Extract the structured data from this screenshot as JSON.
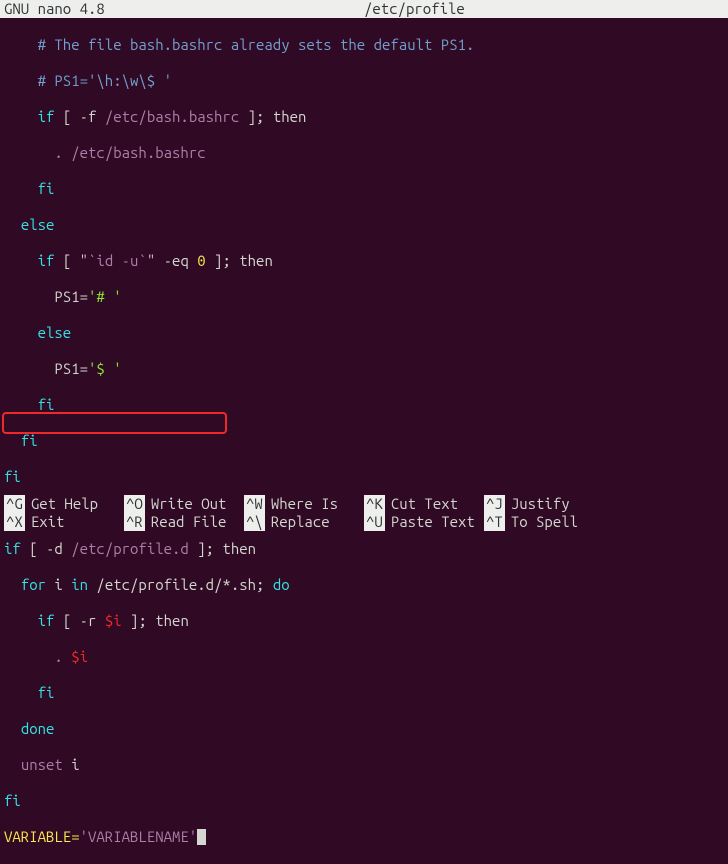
{
  "header": {
    "app": "GNU nano 4.8",
    "filename": "/etc/profile"
  },
  "code": {
    "l1_comment": "# The file bash.bashrc already sets the default PS1.",
    "l2_comment": "# PS1='\\h:\\w\\$ '",
    "l3_if": "if",
    "l3_test": " [ -f ",
    "l3_path": "/etc/bash.bashrc",
    "l3_then": " ]; then",
    "l4_dot": ". ",
    "l4_path": "/etc/bash.bashrc",
    "l5_fi": "fi",
    "l6_else": "else",
    "l7_if": "if",
    "l7_test": " [ \"",
    "l7_cmd": "`id -u`",
    "l7_eq": "\" -eq ",
    "l7_num": "0",
    "l7_then": " ]; then",
    "l8_ps1": "PS1=",
    "l8_val": "'# '",
    "l9_else": "else",
    "l10_ps1": "PS1=",
    "l10_val": "'$ '",
    "l11_fi": "fi",
    "l12_fi": "fi",
    "l13_fi": "fi",
    "l15_if": "if",
    "l15_test": " [ -d ",
    "l15_path": "/etc/profile.d",
    "l15_then": " ]; then",
    "l16_for": "for",
    "l16_var": " i ",
    "l16_in": "in",
    "l16_path": " /etc/profile.d/*.sh; ",
    "l16_do": "do",
    "l17_if": "if",
    "l17_test": " [ -r ",
    "l17_var": "$i",
    "l17_then": " ]; then",
    "l18_dot": ". ",
    "l18_var": "$i",
    "l19_fi": "fi",
    "l20_done": "done",
    "l21_unset": "unset",
    "l21_var": " i",
    "l22_fi": "fi",
    "l23_var": "VARIABLE=",
    "l23_val": "'VARIABLENAME'"
  },
  "shortcuts": [
    {
      "key": "^G",
      "label": "Get Help"
    },
    {
      "key": "^X",
      "label": "Exit"
    },
    {
      "key": "^O",
      "label": "Write Out"
    },
    {
      "key": "^R",
      "label": "Read File"
    },
    {
      "key": "^W",
      "label": "Where Is"
    },
    {
      "key": "^\\",
      "label": "Replace"
    },
    {
      "key": "^K",
      "label": "Cut Text"
    },
    {
      "key": "^U",
      "label": "Paste Text"
    },
    {
      "key": "^J",
      "label": "Justify"
    },
    {
      "key": "^T",
      "label": "To Spell"
    }
  ]
}
